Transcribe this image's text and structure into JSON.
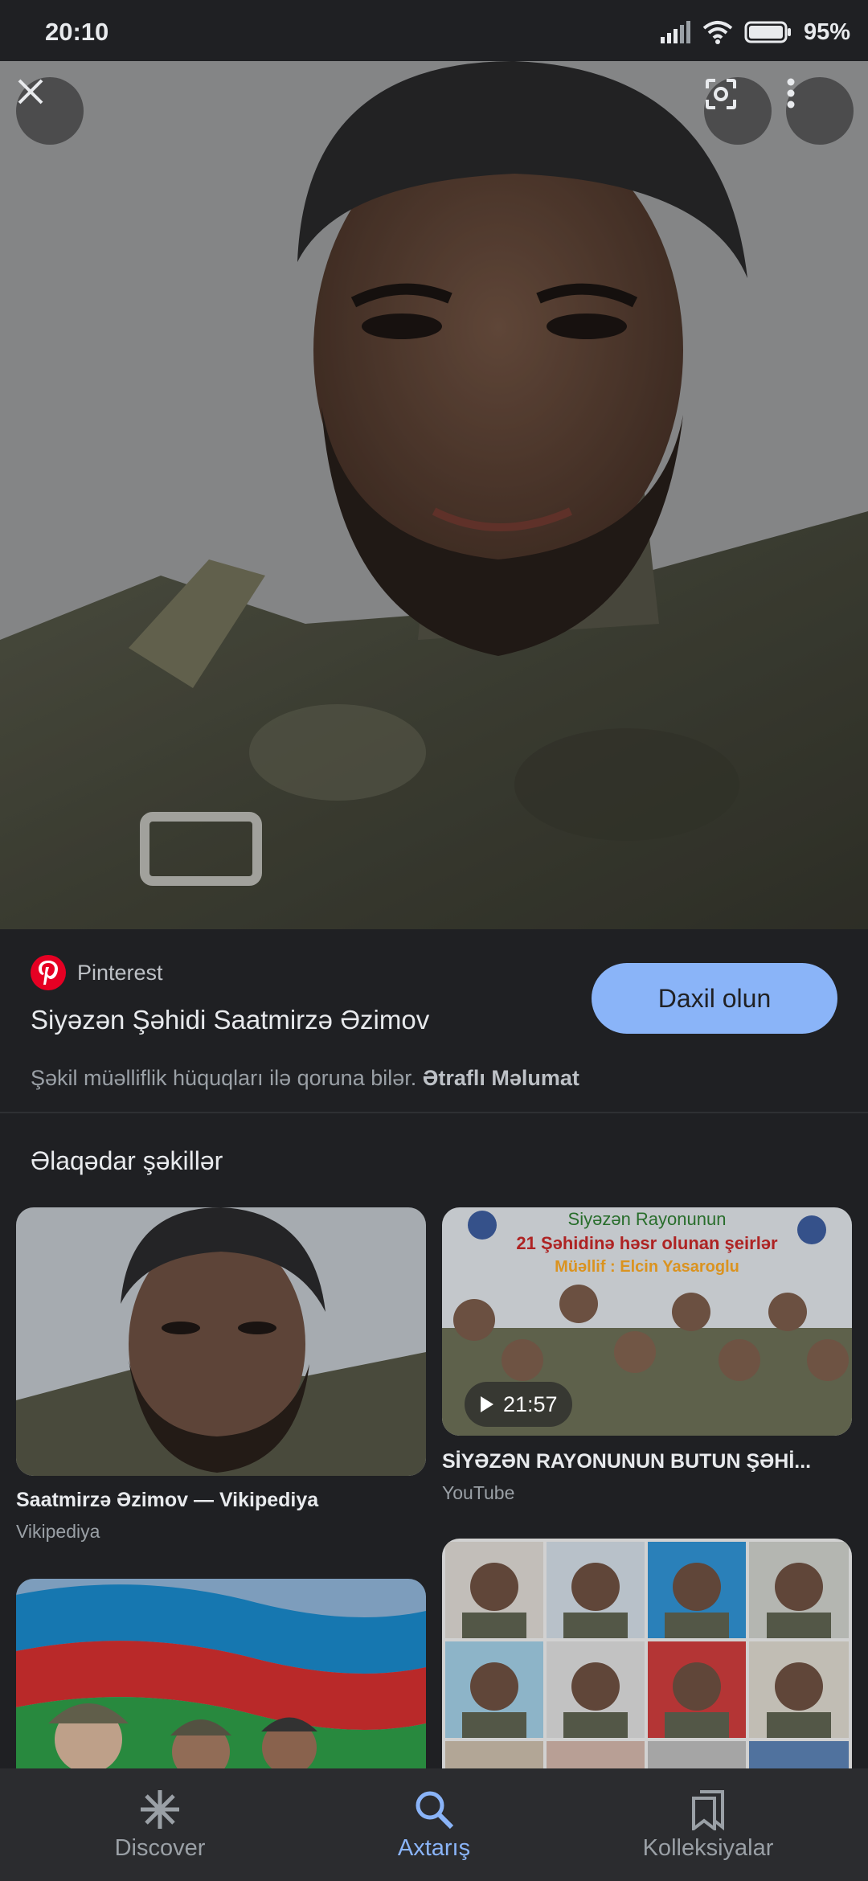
{
  "status_bar": {
    "time": "20:10",
    "battery": "95%"
  },
  "result": {
    "source": "Pinterest",
    "title": "Siyəzən Şəhidi Saatmirzə Əzimov",
    "visit_button": "Daxil olun",
    "copyright_text": "Şəkil müəlliflik hüquqları ilə qoruna bilər.",
    "copyright_link": "Ətraflı Məlumat"
  },
  "related": {
    "heading": "Əlaqədar şəkillər",
    "items": [
      {
        "title": "Saatmirzə Əzimov — Vikipediya",
        "source": "Vikipediya"
      },
      {
        "title": "SİYƏZƏN RAYONUNUN BUTUN ŞƏHİ...",
        "source": "YouTube",
        "duration": "21:57",
        "overlay_lines": [
          "Siyəzən Rayonunun",
          "21 Şəhidinə həsr olunan şeirlər",
          "Müəllif : Elcin Yasaroglu"
        ]
      },
      {
        "title": "",
        "source": ""
      },
      {
        "title": "",
        "source": ""
      }
    ]
  },
  "nav": {
    "items": [
      {
        "label": "Discover",
        "icon": "asterisk-icon"
      },
      {
        "label": "Axtarış",
        "icon": "search-icon",
        "active": true
      },
      {
        "label": "Kolleksiyalar",
        "icon": "bookmarks-icon"
      }
    ]
  }
}
